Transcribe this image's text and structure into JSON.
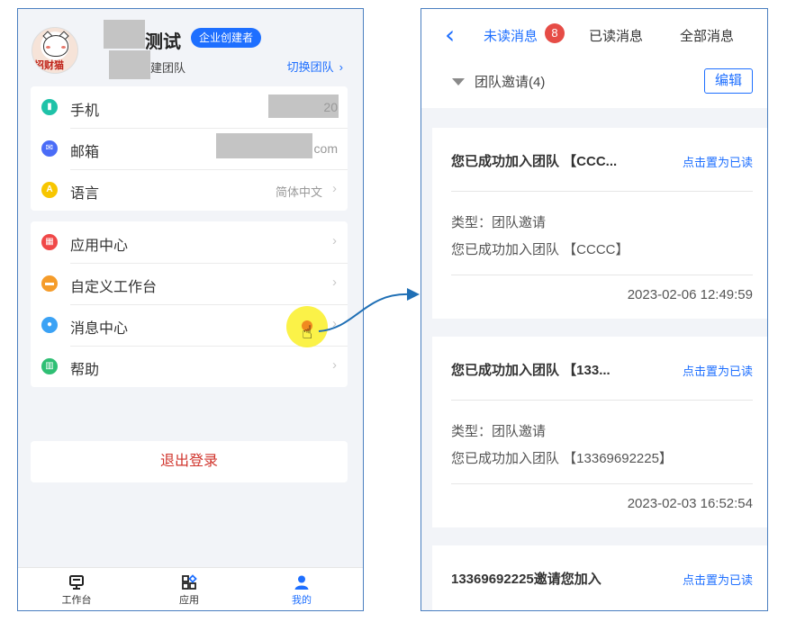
{
  "left": {
    "profile": {
      "name_suffix": "测试",
      "role_badge": "企业创建者",
      "team_suffix": "建团队",
      "switch_team": "切换团队",
      "avatar_text": "招财猫"
    },
    "account_rows": [
      {
        "label": "手机",
        "value_tail": "20",
        "icon": "phone-icon",
        "color": "#1fc2a8"
      },
      {
        "label": "邮箱",
        "value_tail": "com",
        "icon": "mail-icon",
        "color": "#4a6cf7"
      },
      {
        "label": "语言",
        "value": "简体中文",
        "icon": "language-icon",
        "color": "#f7c600"
      }
    ],
    "menu_rows": [
      {
        "label": "应用中心",
        "icon": "apps-icon",
        "color": "#f04848"
      },
      {
        "label": "自定义工作台",
        "icon": "workbench-icon",
        "color": "#f59c2a"
      },
      {
        "label": "消息中心",
        "icon": "message-icon",
        "color": "#3ba2f5"
      },
      {
        "label": "帮助",
        "icon": "book-icon",
        "color": "#2fbf74"
      }
    ],
    "logout": "退出登录",
    "tabbar": [
      {
        "label": "工作台",
        "icon": "monitor-icon",
        "active": false
      },
      {
        "label": "应用",
        "icon": "grid-icon",
        "active": false
      },
      {
        "label": "我的",
        "icon": "user-icon",
        "active": true
      }
    ]
  },
  "right": {
    "tabs": [
      {
        "label": "未读消息",
        "active": true
      },
      {
        "label": "已读消息",
        "active": false
      },
      {
        "label": "全部消息",
        "active": false
      }
    ],
    "unread_count": "8",
    "group_title": "团队邀请(4)",
    "edit": "编辑",
    "mark_read": "点击置为已读",
    "messages": [
      {
        "title": "您已成功加入团队 【CCC...",
        "type": "类型：团队邀请",
        "body": "您已成功加入团队 【CCCC】",
        "time": "2023-02-06 12:49:59"
      },
      {
        "title": "您已成功加入团队 【133...",
        "type": "类型：团队邀请",
        "body": "您已成功加入团队 【13369692225】",
        "time": "2023-02-03 16:52:54"
      },
      {
        "title": "13369692225邀请您加入"
      }
    ]
  },
  "colors": {
    "accent": "#1e6fff",
    "danger": "#d0342c",
    "frame": "#4a7fc0",
    "highlight": "#faf028"
  }
}
